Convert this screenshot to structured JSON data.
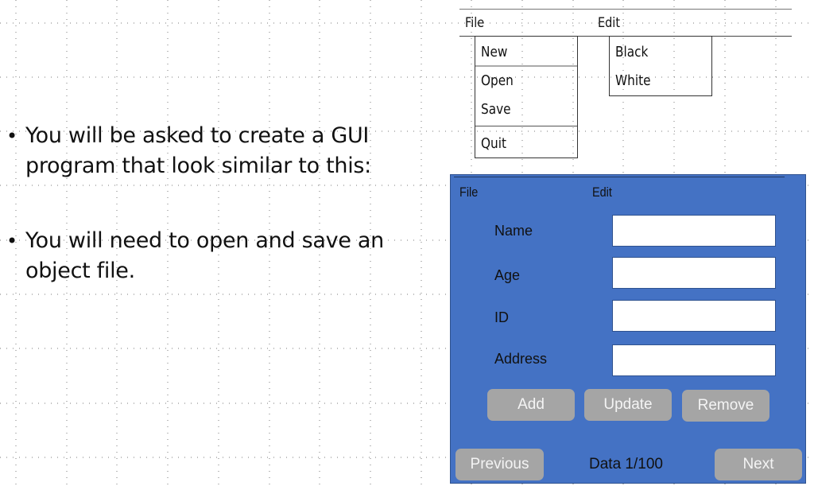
{
  "slide": {
    "bullets": [
      {
        "text": "You will be asked to create a GUI program that look similar to this:",
        "lines": [
          "You will be asked to create a GUI",
          "program that look similar to this:"
        ]
      },
      {
        "text": "You will need to open and save an object file.",
        "lines": [
          "You will need to open and save an",
          "object file."
        ]
      }
    ],
    "bullet_glyph": "•"
  },
  "menu_mockup": {
    "menus": [
      {
        "label": "File",
        "items": [
          "New",
          "Open",
          "Save",
          "Quit"
        ]
      },
      {
        "label": "Edit",
        "items": [
          "Black",
          "White"
        ]
      }
    ]
  },
  "app_window": {
    "background_color": "#4472c4",
    "menubar": [
      "File",
      "Edit"
    ],
    "fields": [
      {
        "label": "Name",
        "value": ""
      },
      {
        "label": "Age",
        "value": ""
      },
      {
        "label": "ID",
        "value": ""
      },
      {
        "label": "Address",
        "value": ""
      }
    ],
    "actions": [
      "Add",
      "Update",
      "Remove"
    ],
    "navigation": {
      "previous_label": "Previous",
      "next_label": "Next",
      "status": "Data 1/100",
      "current": 1,
      "total": 100
    },
    "button_color": "#a5a5a5"
  }
}
